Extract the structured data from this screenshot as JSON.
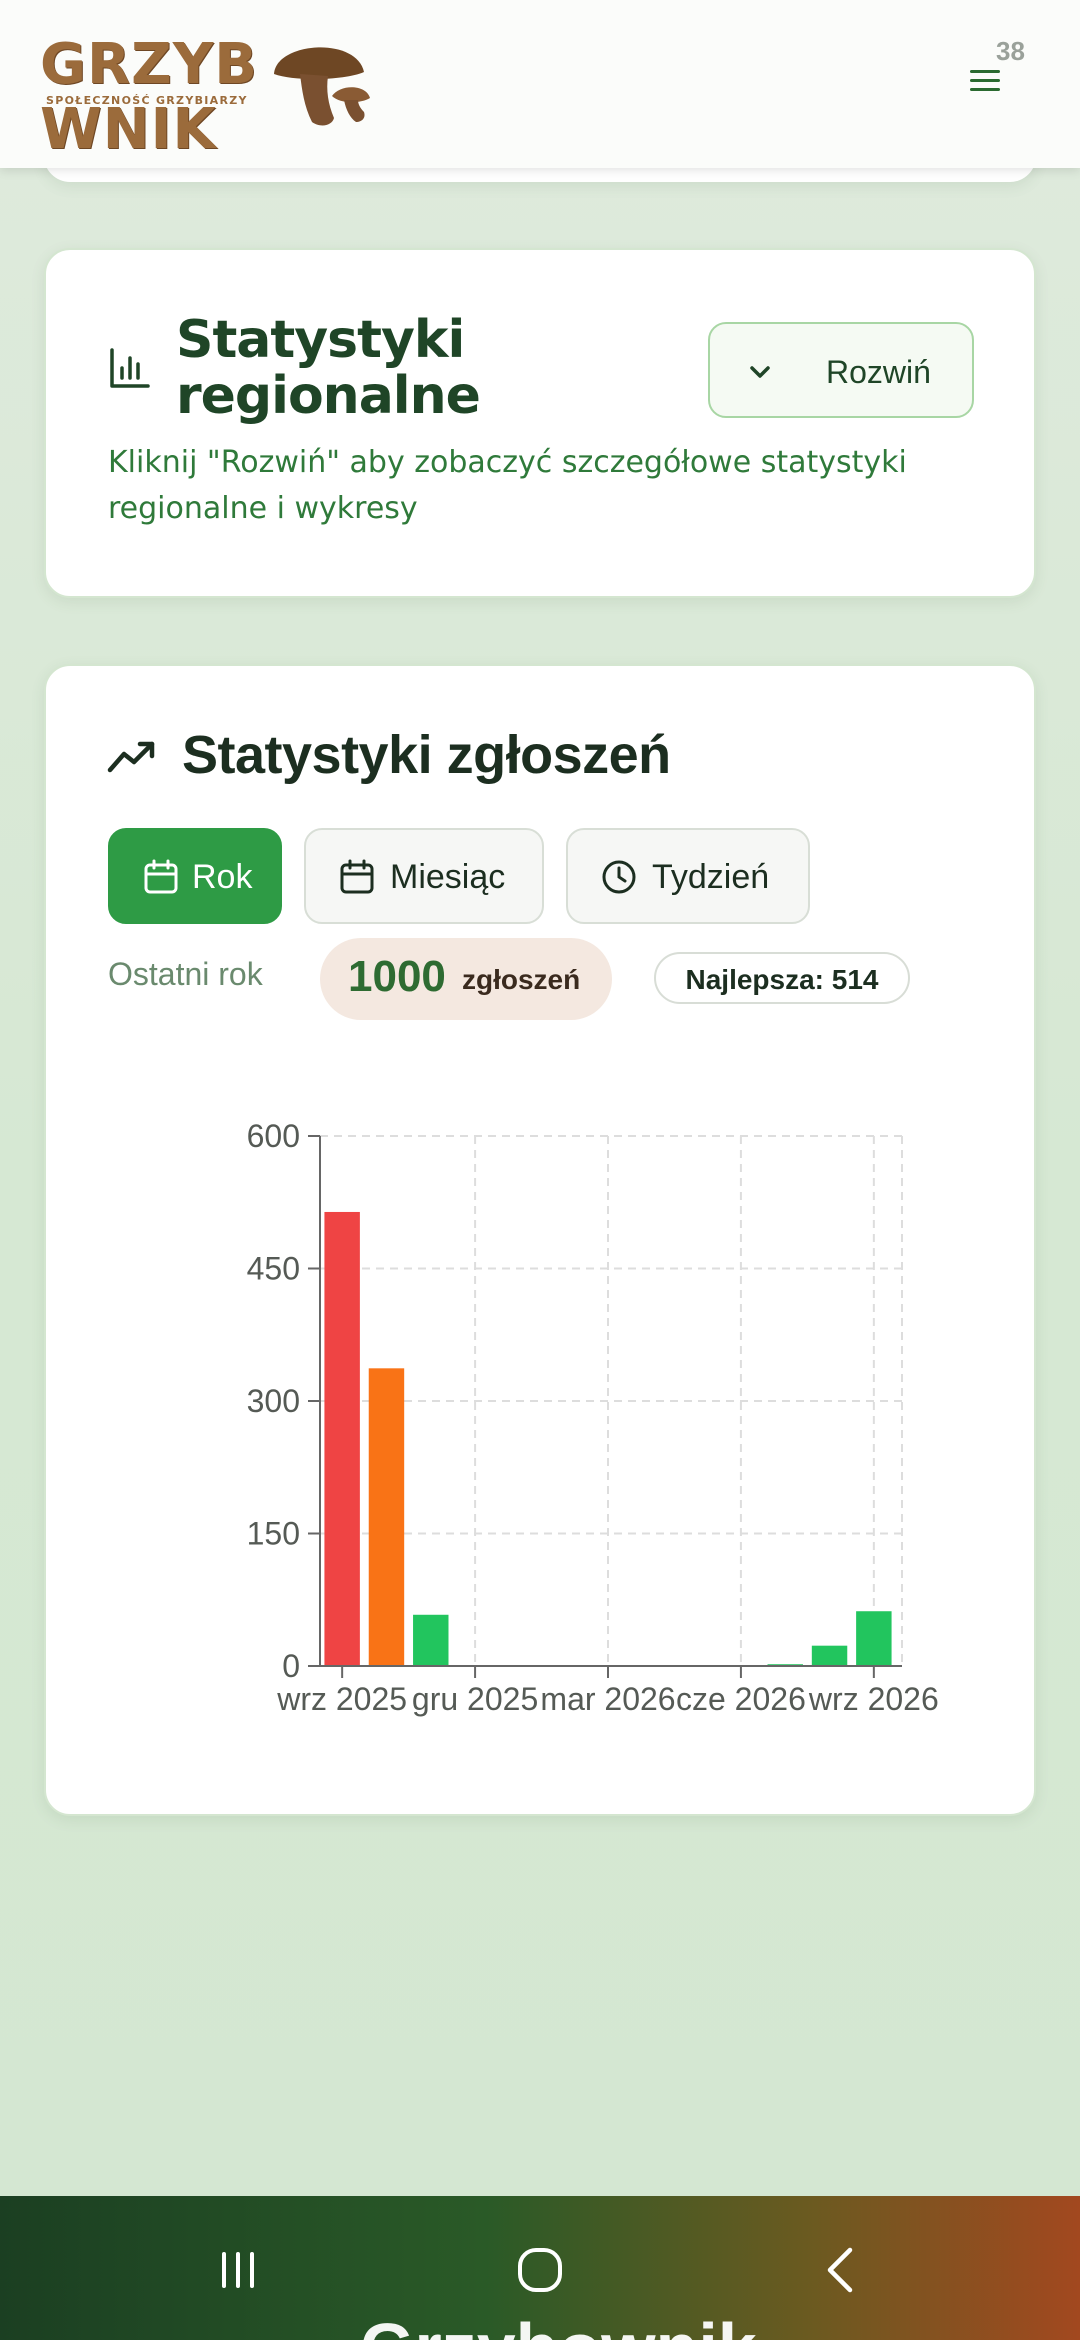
{
  "header": {
    "logo_text": "GRZYBOWNIK",
    "logo_left": "GRZYB",
    "logo_right": "WNIK",
    "logo_subtitle": "SPOŁECZNOŚĆ GRZYBIARZY",
    "menu_badge": "38",
    "menu_icon": "hamburger-icon"
  },
  "regional": {
    "icon": "bar-chart-icon",
    "title": "Statystyki regionalne",
    "expand_label": "Rozwiń",
    "expand_icon": "chevron-down-icon",
    "description": "Kliknij \"Rozwiń\" aby zobaczyć szczegółowe statystyki regionalne i wykresy"
  },
  "stats": {
    "icon": "trending-up-icon",
    "title": "Statystyki zgłoszeń",
    "tabs": [
      {
        "label": "Rok",
        "icon": "calendar-icon",
        "active": true
      },
      {
        "label": "Miesiąc",
        "icon": "calendar-icon",
        "active": false
      },
      {
        "label": "Tydzień",
        "icon": "clock-icon",
        "active": false
      }
    ],
    "period_label": "Ostatni rok",
    "count_value": "1000",
    "count_unit": "zgłoszeń",
    "best_label": "Najlepsza: 514"
  },
  "chart_data": {
    "type": "bar",
    "x": [
      "2025-09",
      "2025-10",
      "2025-11",
      "2025-12",
      "2026-01",
      "2026-02",
      "2026-03",
      "2026-04",
      "2026-05",
      "2026-06",
      "2026-07",
      "2026-08",
      "2026-09"
    ],
    "values": [
      514,
      337,
      58,
      0,
      0,
      0,
      0,
      0,
      0,
      1,
      2,
      23,
      62
    ],
    "bar_colors": [
      "#ef4444",
      "#f97316",
      "#22c55e",
      "#22c55e",
      "#22c55e",
      "#22c55e",
      "#22c55e",
      "#22c55e",
      "#22c55e",
      "#22c55e",
      "#22c55e",
      "#22c55e",
      "#22c55e"
    ],
    "y_ticks": [
      0,
      150,
      300,
      450,
      600
    ],
    "ylim": [
      0,
      600
    ],
    "x_tick_labels": [
      "wrz 2025",
      "gru 2025",
      "mar 2026",
      "cze 2026",
      "wrz 2026"
    ],
    "x_tick_index": [
      0,
      3,
      6,
      9,
      12
    ],
    "grid": true
  },
  "system_nav": {
    "recents_icon": "recents-icon",
    "home_icon": "home-icon",
    "back_icon": "back-icon",
    "peek_text": "Grzybownik"
  },
  "colors": {
    "accent": "#2e9b45",
    "brand_brown": "#9b6b3b",
    "title_green": "#1f4527"
  }
}
